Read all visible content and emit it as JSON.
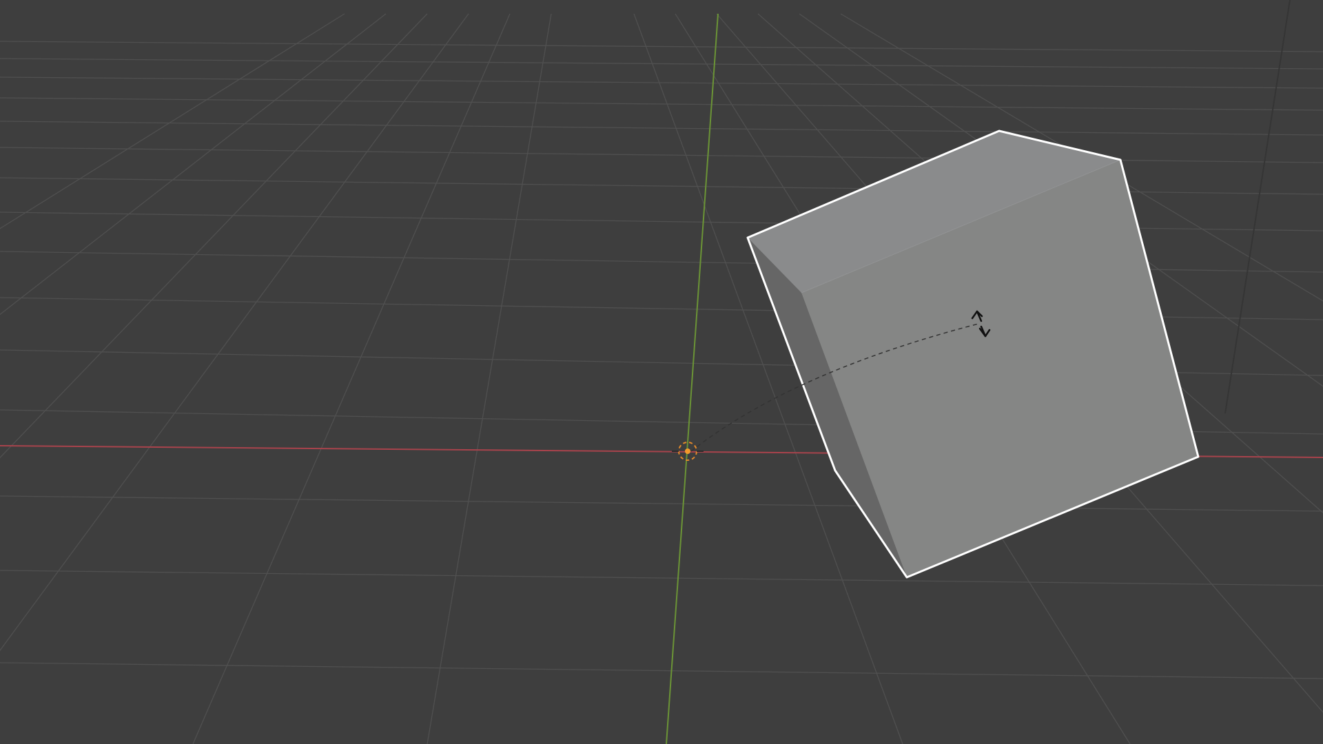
{
  "viewport": {
    "background_color": "#3e3e3e",
    "grid_color": "#4f4f4f",
    "x_axis_color": "#b3404a",
    "y_axis_color": "#6e9a34"
  },
  "cube": {
    "top_face_color": "#8b8c8d",
    "front_face_color": "#858685",
    "side_face_color": "#666666",
    "outline_color": "#ffffff",
    "selected": true
  },
  "object_origin": {
    "icon": "origin-dot-icon",
    "color": "#f39a2b"
  },
  "transform_cursor": {
    "icon": "rotate-cursor-icon",
    "mode": "rotate"
  }
}
